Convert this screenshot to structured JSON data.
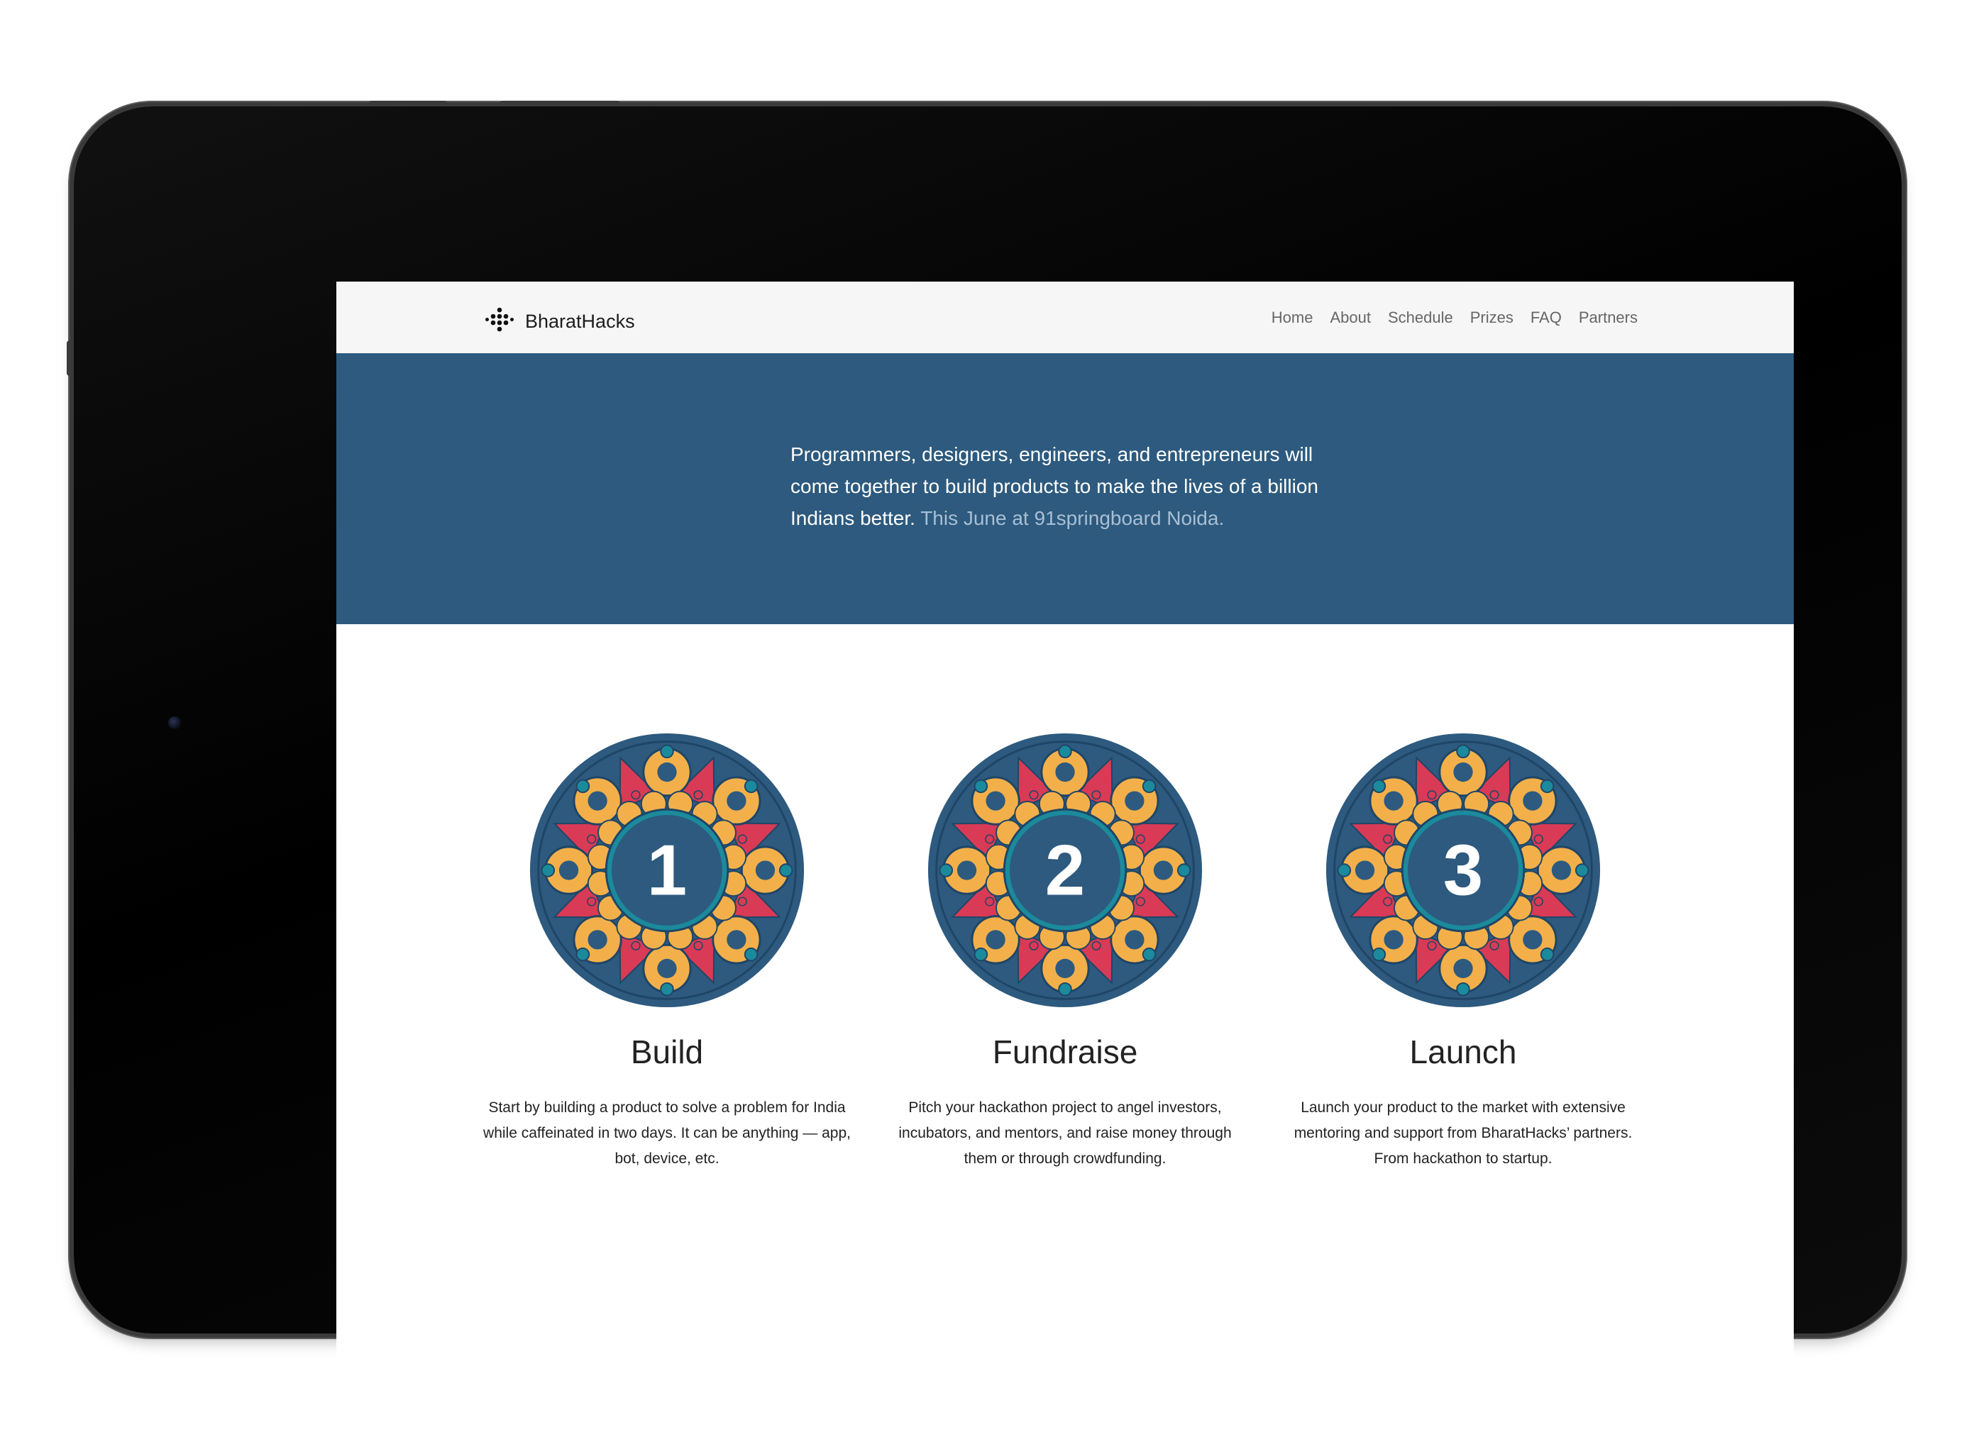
{
  "brand": {
    "name": "BharatHacks",
    "logo_icon": "dots-logo-icon"
  },
  "nav": {
    "items": [
      "Home",
      "About",
      "Schedule",
      "Prizes",
      "FAQ",
      "Partners"
    ]
  },
  "hero": {
    "text": "Programmers, designers, engineers, and entrepreneurs will come together to build products to make the lives of a billion Indians better.",
    "subtext": "This June at 91springboard Noida."
  },
  "steps": [
    {
      "number": "1",
      "title": "Build",
      "description": "Start by building a product to solve a problem for India while caffeinated in two days. It can be anything — app, bot, device, etc."
    },
    {
      "number": "2",
      "title": "Fundraise",
      "description": "Pitch your hackathon project to angel investors, incubators, and mentors, and raise money through them or through crowdfunding."
    },
    {
      "number": "3",
      "title": "Launch",
      "description": "Launch your product to the market with extensive mentoring and support from BharatHacks’ partners. From hackathon to startup."
    }
  ],
  "colors": {
    "primary_blue": "#2d5a7e",
    "mandala_orange": "#f3b04a",
    "mandala_red": "#d93a55",
    "mandala_teal": "#1b8a9c",
    "navbar_bg": "#f6f6f6"
  }
}
